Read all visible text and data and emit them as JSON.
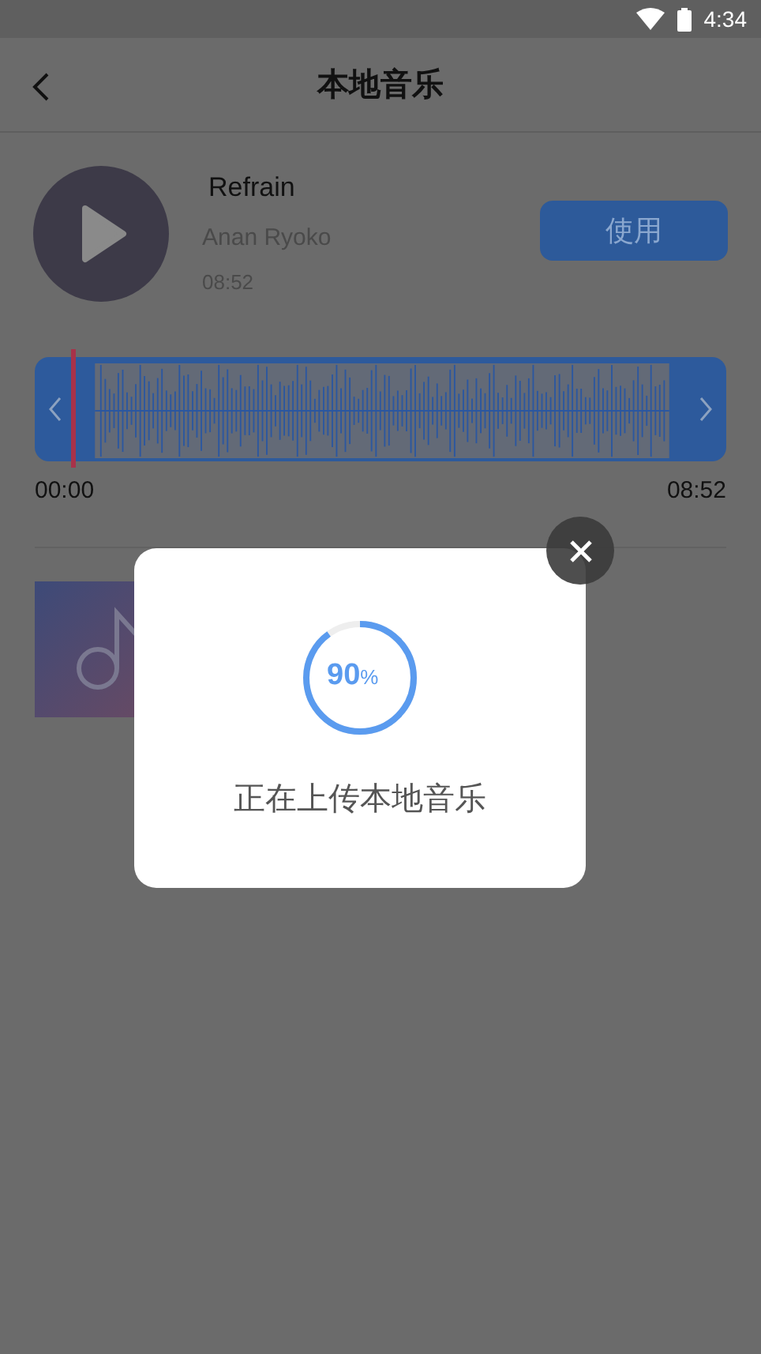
{
  "status_bar": {
    "time": "4:34"
  },
  "header": {
    "title": "本地音乐"
  },
  "song": {
    "title": "Refrain",
    "artist": "Anan Ryoko",
    "duration": "08:52"
  },
  "use_button": {
    "label": "使用"
  },
  "waveform": {
    "start": "00:00",
    "end": "08:52"
  },
  "dialog": {
    "progress": {
      "value": "90",
      "unit": "%"
    },
    "message": "正在上传本地音乐"
  }
}
